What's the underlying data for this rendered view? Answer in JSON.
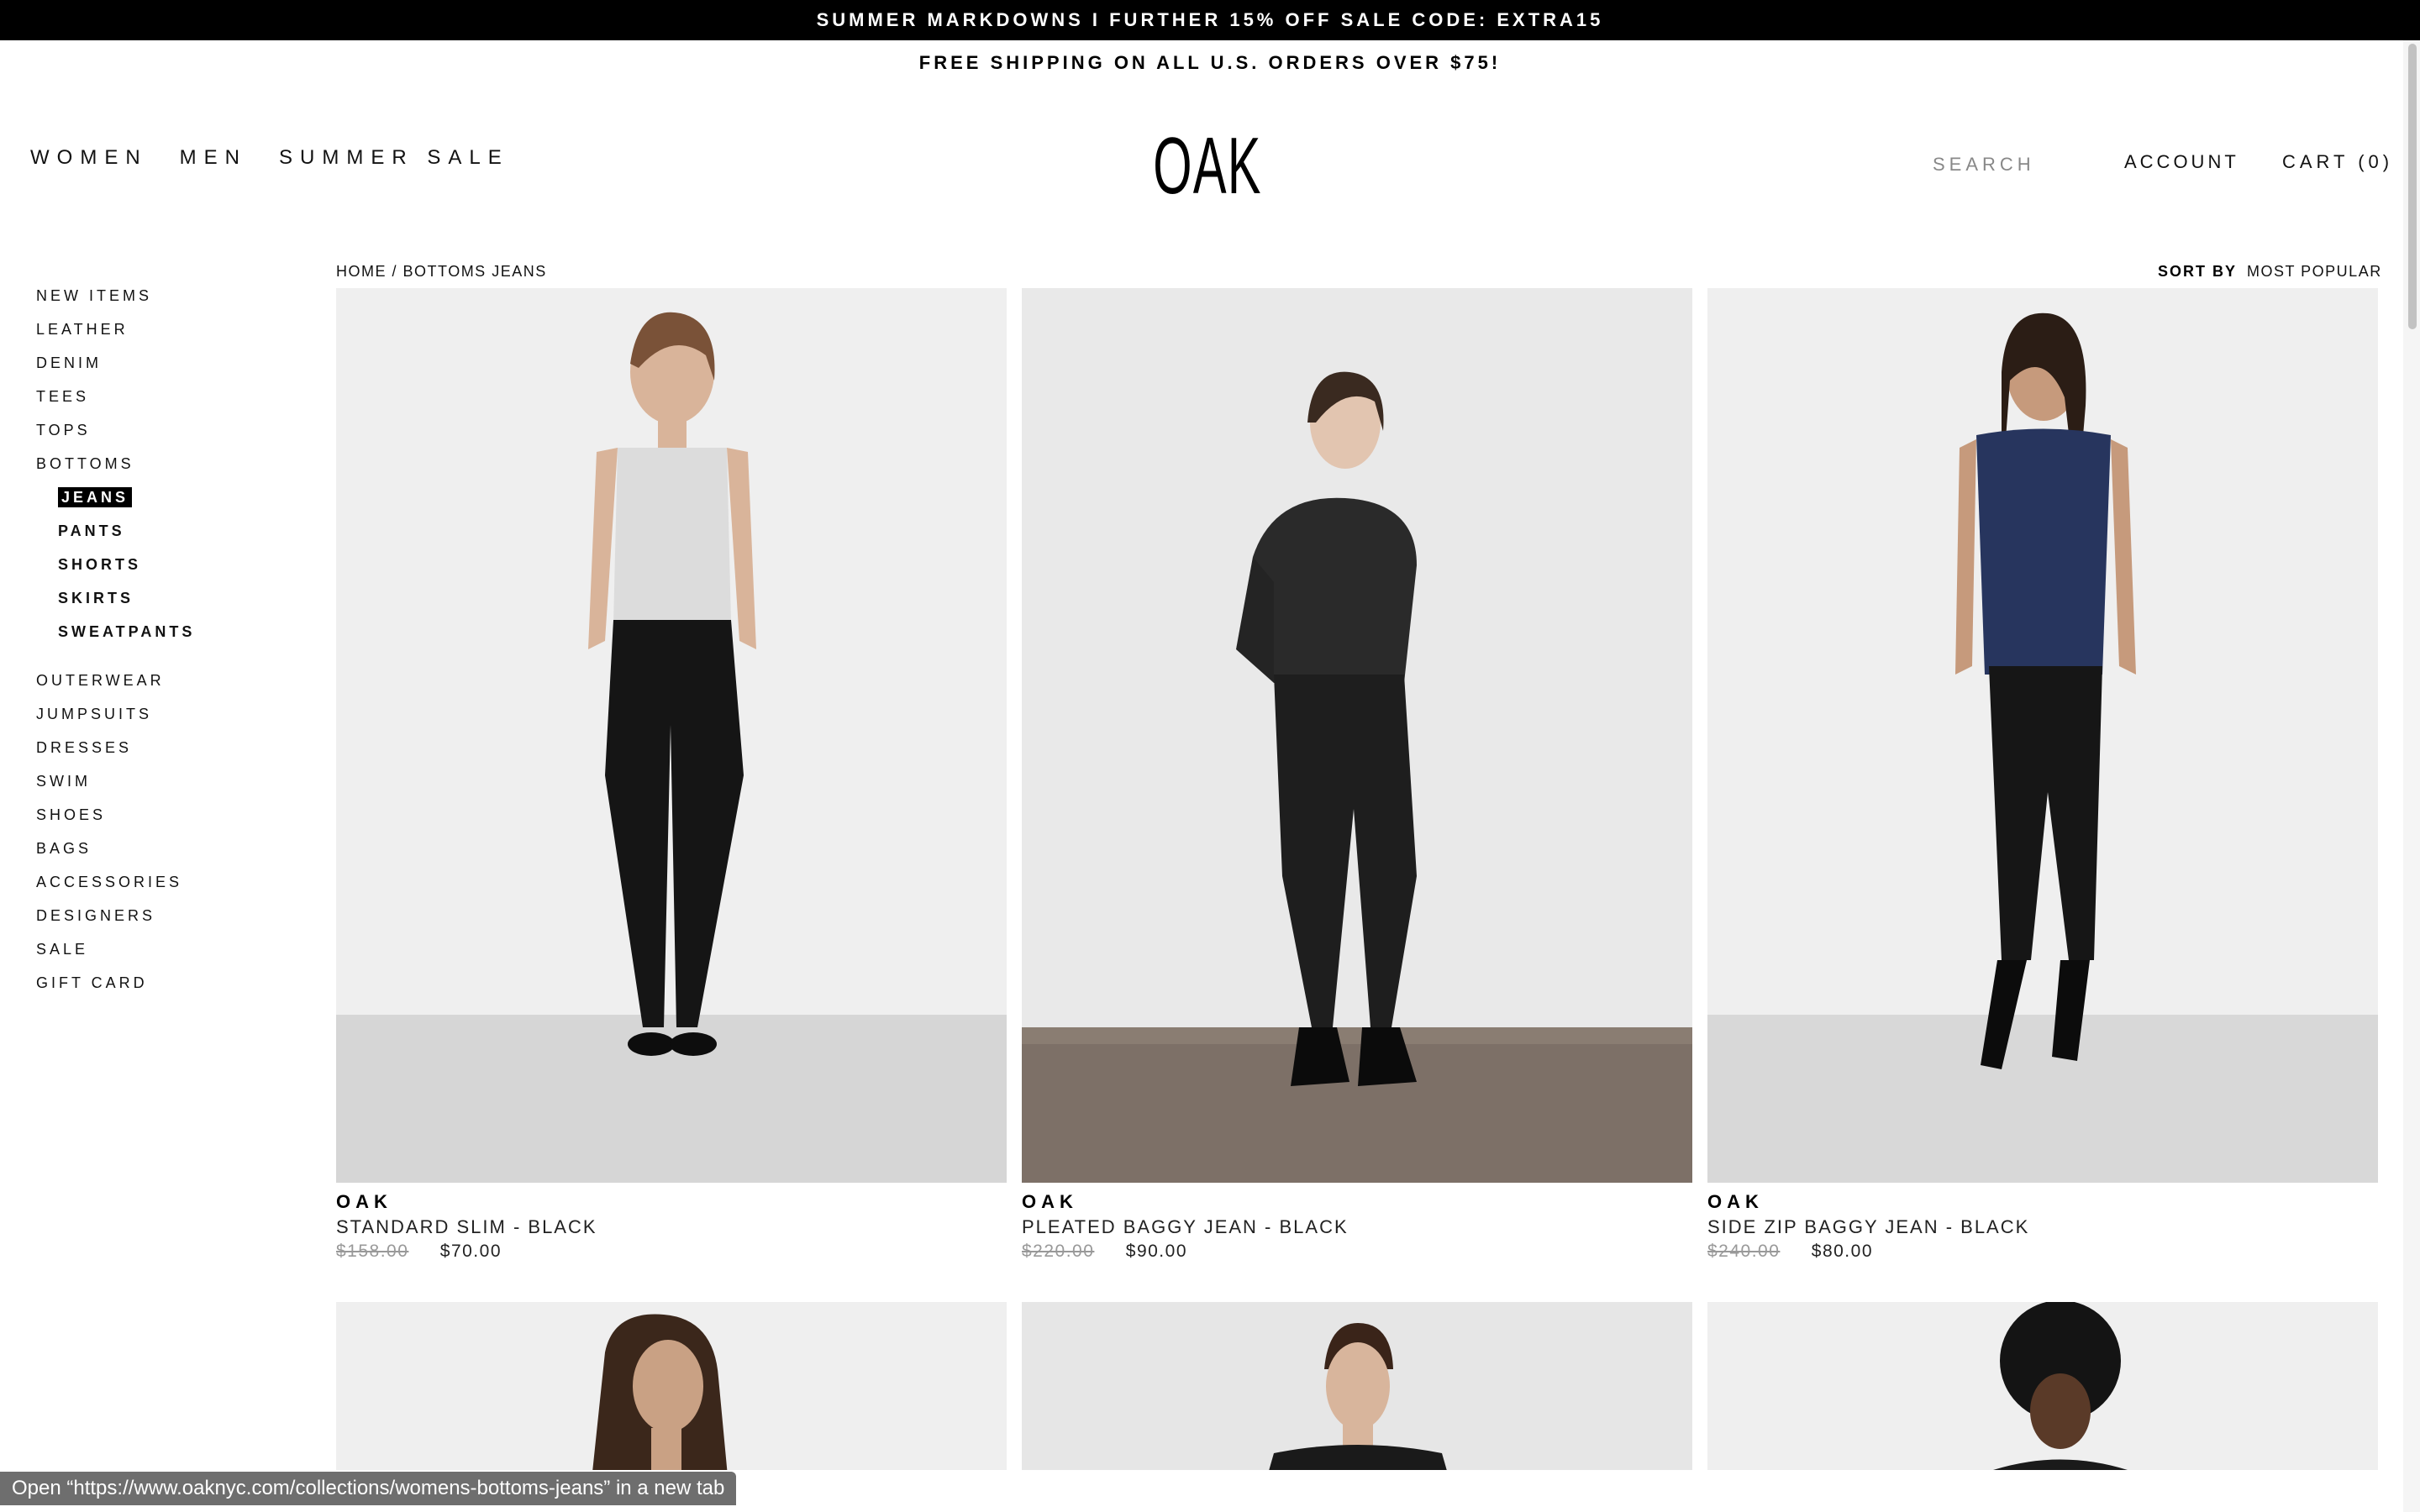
{
  "promo": {
    "text": "SUMMER MARKDOWNS I FURTHER 15% OFF SALE CODE: EXTRA15"
  },
  "shipping": {
    "text": "FREE SHIPPING ON ALL U.S. ORDERS OVER $75!"
  },
  "header": {
    "nav": [
      "WOMEN",
      "MEN",
      "SUMMER SALE"
    ],
    "logo": "OAK",
    "search_placeholder": "SEARCH",
    "account": "ACCOUNT",
    "cart": "CART (0)"
  },
  "sidebar": {
    "items": [
      "NEW ITEMS",
      "LEATHER",
      "DENIM",
      "TEES",
      "TOPS",
      "BOTTOMS"
    ],
    "subitems": [
      "JEANS",
      "PANTS",
      "SHORTS",
      "SKIRTS",
      "SWEATPANTS"
    ],
    "active_subitem": "JEANS",
    "more_items": [
      "OUTERWEAR",
      "JUMPSUITS",
      "DRESSES",
      "SWIM",
      "SHOES",
      "BAGS",
      "ACCESSORIES",
      "DESIGNERS",
      "SALE",
      "GIFT CARD"
    ]
  },
  "breadcrumb": {
    "home": "HOME",
    "separator": " / ",
    "current": "BOTTOMS JEANS"
  },
  "sort": {
    "label": "SORT BY",
    "value": "MOST POPULAR"
  },
  "products": [
    {
      "brand": "OAK",
      "name": "STANDARD SLIM - BLACK",
      "old_price": "$158.00",
      "price": "$70.00"
    },
    {
      "brand": "OAK",
      "name": "PLEATED BAGGY JEAN - BLACK",
      "old_price": "$220.00",
      "price": "$90.00"
    },
    {
      "brand": "OAK",
      "name": "SIDE ZIP BAGGY JEAN - BLACK",
      "old_price": "$240.00",
      "price": "$80.00"
    }
  ],
  "status_tooltip": "Open “https://www.oaknyc.com/collections/womens-bottoms-jeans” in a new tab",
  "colors": {
    "promo_bg": "#000000",
    "active_bg": "#000000",
    "price_old": "#999999"
  }
}
